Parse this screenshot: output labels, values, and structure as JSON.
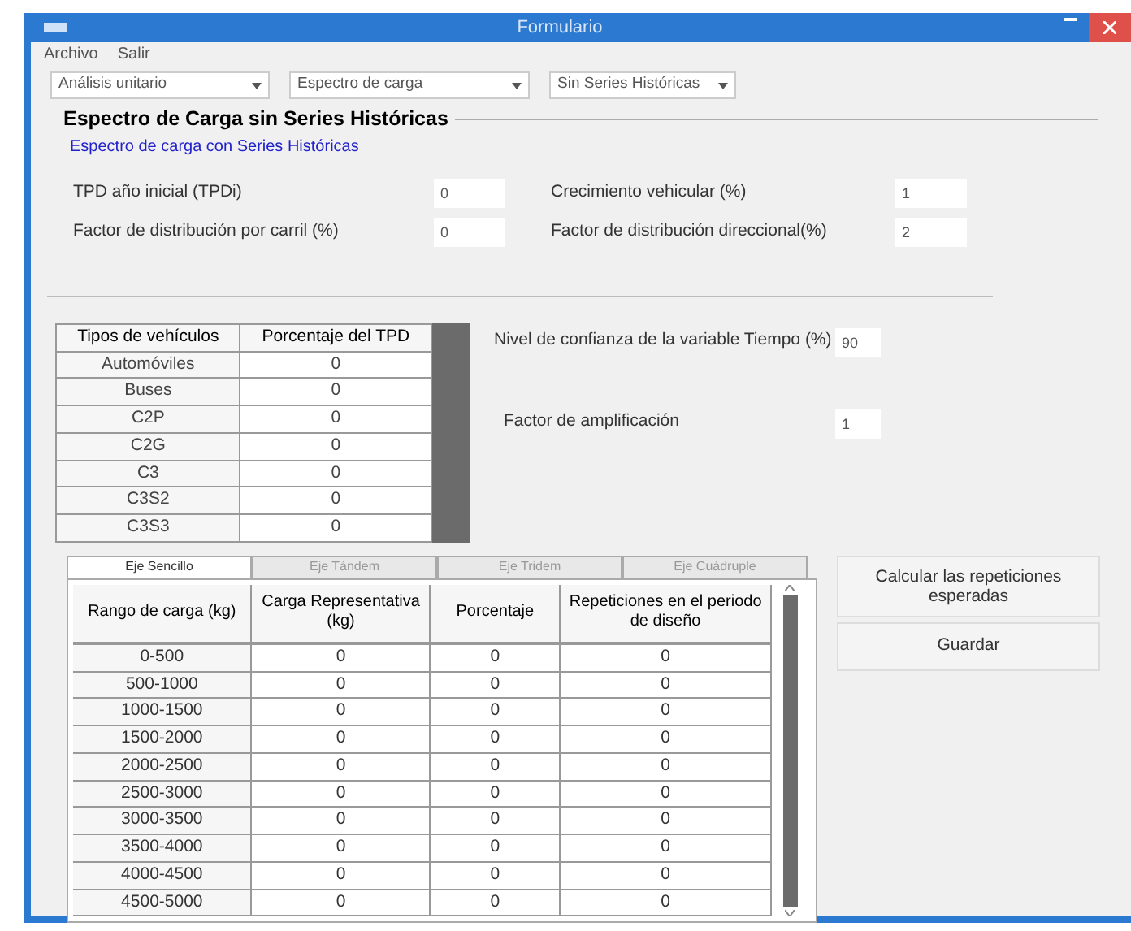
{
  "window": {
    "title": "Formulario"
  },
  "menu": [
    "Archivo",
    "Salir"
  ],
  "dropdowns": [
    {
      "value": "Análisis unitario"
    },
    {
      "value": "Espectro de carga"
    },
    {
      "value": "Sin Series Históricas"
    }
  ],
  "group": {
    "title": "Espectro de Carga sin Series Históricas",
    "link": "Espectro de carga con Series Históricas"
  },
  "fields": [
    {
      "label": "TPD año inicial (TPDi)",
      "value": "0"
    },
    {
      "label": "Crecimiento vehicular (%)",
      "value": "1"
    },
    {
      "label": "Factor de distribución por carril (%)",
      "value": "0"
    },
    {
      "label": "Factor de distribución direccional(%)",
      "value": "2"
    }
  ],
  "vehicle_table": {
    "columns": [
      "Tipos de vehículos",
      "Porcentaje del TPD"
    ],
    "rows": [
      [
        "Automóviles",
        "0"
      ],
      [
        "Buses",
        "0"
      ],
      [
        "C2P",
        "0"
      ],
      [
        "C2G",
        "0"
      ],
      [
        "C3",
        "0"
      ],
      [
        "C3S2",
        "0"
      ],
      [
        "C3S3",
        "0"
      ]
    ]
  },
  "side_fields": [
    {
      "label": "Nivel de confianza de la variable Tiempo (%)",
      "value": "90"
    },
    {
      "label": "Factor de amplificación",
      "value": "1"
    }
  ],
  "tabs": [
    {
      "label": "Eje Sencillo",
      "selected": true
    },
    {
      "label": "Eje Tándem",
      "selected": false
    },
    {
      "label": "Eje Tridem",
      "selected": false
    },
    {
      "label": "Eje Cuádruple",
      "selected": false
    }
  ],
  "load_table": {
    "columns": [
      "Rango de carga (kg)",
      "Carga Representativa (kg)",
      "Porcentaje",
      "Repeticiones en el periodo de diseño"
    ],
    "rows": [
      [
        "0-500",
        "0",
        "0",
        "0"
      ],
      [
        "500-1000",
        "0",
        "0",
        "0"
      ],
      [
        "1000-1500",
        "0",
        "0",
        "0"
      ],
      [
        "1500-2000",
        "0",
        "0",
        "0"
      ],
      [
        "2000-2500",
        "0",
        "0",
        "0"
      ],
      [
        "2500-3000",
        "0",
        "0",
        "0"
      ],
      [
        "3000-3500",
        "0",
        "0",
        "0"
      ],
      [
        "3500-4000",
        "0",
        "0",
        "0"
      ],
      [
        "4000-4500",
        "0",
        "0",
        "0"
      ],
      [
        "4500-5000",
        "0",
        "0",
        "0"
      ]
    ]
  },
  "buttons": [
    "Calcular las repeticiones esperadas",
    "Guardar"
  ]
}
